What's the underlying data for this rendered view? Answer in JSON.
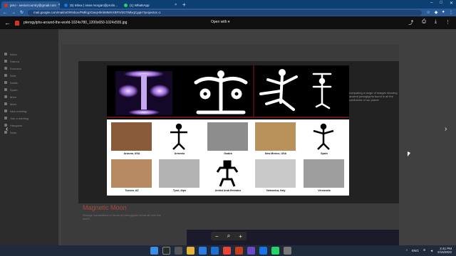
{
  "browser": {
    "tabs": [
      {
        "title": "pmo - seniorcountry@gmail.com",
        "color": "#d93025",
        "active": true
      },
      {
        "title": "(5) Inbox | sean.morgan@prolin...",
        "color": "#1a73e8",
        "active": false
      },
      {
        "title": "(1) WhatsApp",
        "color": "#25d366",
        "active": false
      }
    ],
    "new_tab": "+",
    "url": "mail.google.com/mail/u/0/#inbox/FMfcgzGwqHlmbMMXXBFtVbGTMlxqCgqH?projector=1"
  },
  "viewer": {
    "file_name": "pterogylphs-around-the-world-1024x780_1200x650-1024x555.jpg",
    "open_with": "Open with",
    "zoom_minus": "−",
    "zoom_plus": "+"
  },
  "gmail_background": {
    "side_items": [
      "Inbox",
      "Starred",
      "Snoozed",
      "Sent",
      "Drafts",
      "Spam",
      "More",
      "Meet",
      "New meeting",
      "Join a meeting",
      "Hangouts",
      "Sean"
    ],
    "slide_title": "Magnetic Moon",
    "slide_text": "Strange connections in forms of petroglyphs found all over the world",
    "bg_side_text": "comparing a range of images showing ancient petroglyphs found in all the continents of our planet"
  },
  "petroglyph_image": {
    "labels": [
      "Arizona, USA",
      "Armenia",
      "Guaira",
      "New Mexico, USA",
      "Spain",
      "Tucson, AZ",
      "Tyrol, Alps",
      "United Arab Emirates",
      "Valmonica, Italy",
      "Venezuela"
    ]
  },
  "taskbar": {
    "tray_lang": "ENG",
    "time": "2:41 PM",
    "date": "2/15/2022"
  }
}
